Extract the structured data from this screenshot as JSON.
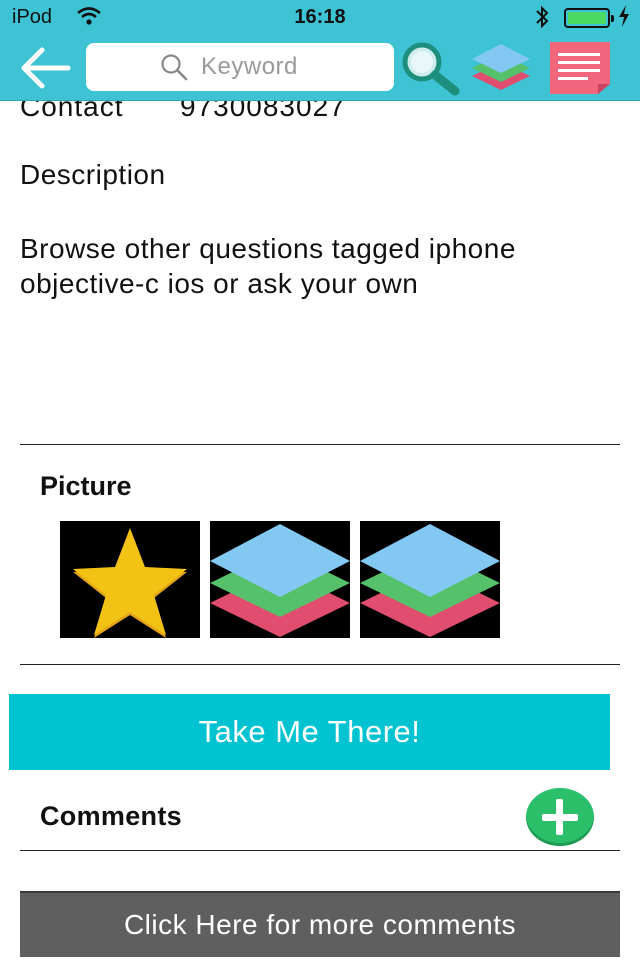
{
  "status_bar": {
    "carrier": "iPod",
    "time": "16:18",
    "wifi_icon": "wifi-icon",
    "bluetooth_icon": "bluetooth-icon",
    "battery_icon": "battery-icon",
    "charging_icon": "bolt-icon"
  },
  "nav": {
    "back_icon": "arrow-left-icon",
    "search": {
      "placeholder": "Keyword",
      "value": ""
    },
    "actions": [
      "search-icon",
      "layers-icon",
      "notes-icon"
    ]
  },
  "detail": {
    "contact_label": "Contact",
    "contact_value": "9730083027",
    "description_heading": "Description",
    "description_text": "Browse other questions tagged iphone objective-c ios or ask your own"
  },
  "pictures": {
    "heading": "Picture",
    "items": [
      "star-picture",
      "layers-picture",
      "layers-picture"
    ]
  },
  "cta": {
    "label": "Take Me There!"
  },
  "comments": {
    "heading": "Comments",
    "add_icon": "plus-circle-icon",
    "more_label": "Click Here for more comments"
  },
  "colors": {
    "topbar": "#3ec3d4",
    "cta": "#00c3d1",
    "add_button": "#2bbf6a",
    "more_button": "#5f5f5f"
  }
}
